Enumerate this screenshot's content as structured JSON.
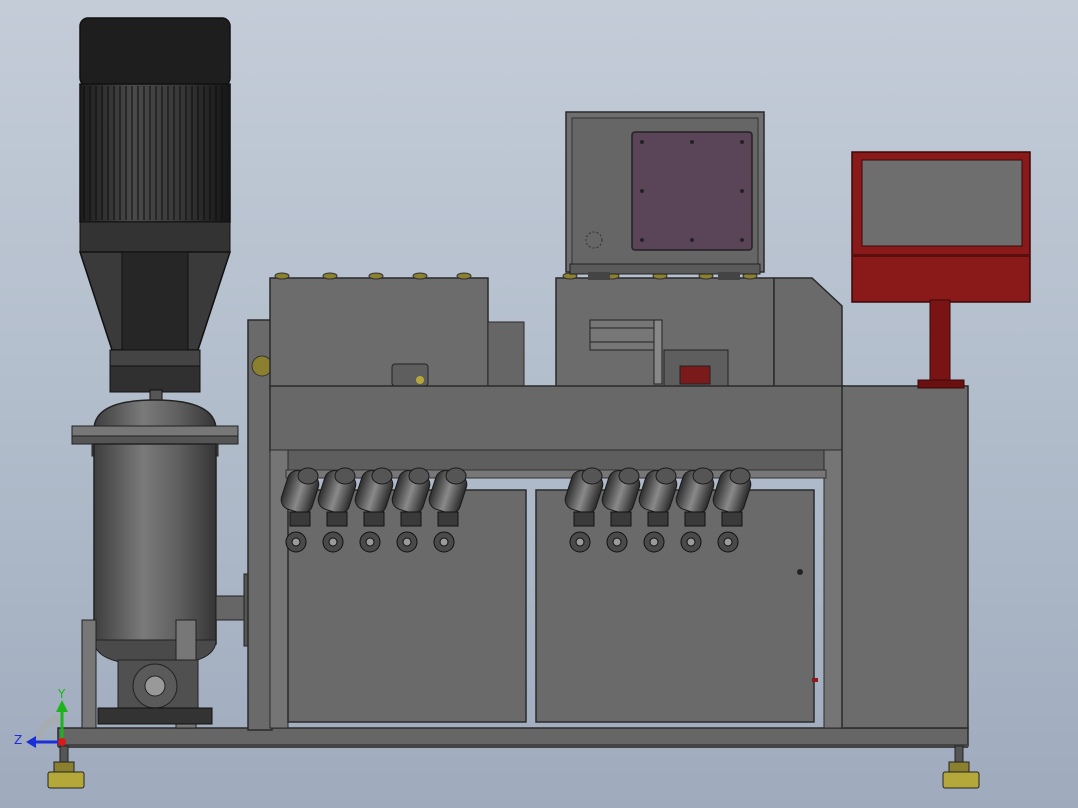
{
  "view": {
    "background_top": "#c4ccd8",
    "background_bottom": "#9fabbd"
  },
  "triad": {
    "y_label": "Y",
    "z_label": "Z",
    "y_color": "#1bb51b",
    "z_color": "#1a2fd8",
    "x_color": "#d81a1a"
  },
  "colors": {
    "steel": "#6c6c6c",
    "steel_dark": "#3c3c3c",
    "motor_black": "#2a2a2a",
    "panel_red": "#8a1a1a",
    "screen_gray": "#6e6e6e",
    "screen_purple": "#5a4458",
    "feet_yellow": "#b5a83a"
  },
  "roller_groups": 2,
  "rollers_per_group": 5
}
